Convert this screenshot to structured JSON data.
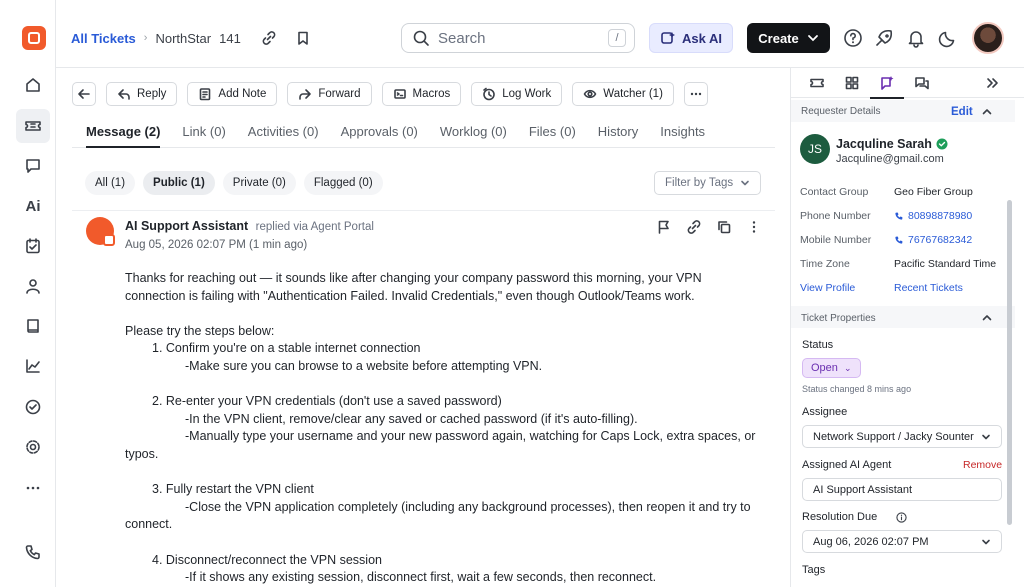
{
  "breadcrumb": {
    "root": "All Tickets",
    "project": "NorthStar",
    "ticket_id": "141"
  },
  "search": {
    "placeholder": "Search",
    "shortcut": "/"
  },
  "header": {
    "ask_ai_label": "Ask AI",
    "create_label": "Create"
  },
  "icons": {
    "rail": [
      "home-icon",
      "ticket-icon",
      "chat-icon",
      "ai-icon",
      "task-icon",
      "contacts-icon",
      "knowledge-icon",
      "reports-icon",
      "check-icon",
      "settings-icon",
      "more-icon",
      "phone-icon"
    ],
    "rail_ai_text": "Ai"
  },
  "actions": {
    "reply": "Reply",
    "add_note": "Add Note",
    "forward": "Forward",
    "macros": "Macros",
    "log_work": "Log Work",
    "watcher": "Watcher (1)"
  },
  "tabs": [
    "Message (2)",
    "Link (0)",
    "Activities (0)",
    "Approvals (0)",
    "Worklog (0)",
    "Files (0)",
    "History",
    "Insights"
  ],
  "filters": {
    "all": "All (1)",
    "public": "Public (1)",
    "private": "Private (0)",
    "flagged": "Flagged (0)",
    "tag_placeholder": "Filter by Tags"
  },
  "message": {
    "author": "AI Support Assistant",
    "via": "replied via Agent Portal",
    "date": "Aug 05, 2026 02:07 PM (1 min ago)",
    "lines": {
      "l1": "Thanks for reaching out — it sounds like after changing your company password this morning, your VPN connection is failing with \"Authentication Failed. Invalid Credentials,\" even though Outlook/Teams work.",
      "l2": "Please try the steps below:",
      "l3": "1. Confirm you're on a stable internet connection",
      "l4": "-Make sure you can browse to a website before attempting VPN.",
      "l5": "2. Re-enter your VPN credentials (don't use a saved password)",
      "l6": "-In the VPN client, remove/clear any saved or cached password (if it's auto-filling).",
      "l7": "-Manually type your username and your new password again, watching for Caps Lock, extra spaces, or typos.",
      "l8": "3. Fully restart the VPN client",
      "l9": "-Close the VPN application completely (including any background processes), then reopen it and try to connect.",
      "l10": "4. Disconnect/reconnect the VPN session",
      "l11": "-If it shows any existing session, disconnect first, wait a few seconds, then reconnect."
    }
  },
  "requester": {
    "section_title": "Requester Details",
    "edit_label": "Edit",
    "initials": "JS",
    "name": "Jacquline Sarah",
    "email": "Jacquline@gmail.com",
    "contact_group_label": "Contact Group",
    "contact_group": "Geo Fiber Group",
    "phone_label": "Phone Number",
    "phone": "80898878980",
    "mobile_label": "Mobile Number",
    "mobile": "76767682342",
    "timezone_label": "Time Zone",
    "timezone": "Pacific Standard Time",
    "view_profile": "View Profile",
    "recent_tickets": "Recent Tickets"
  },
  "ticket_properties": {
    "section_title": "Ticket Properties",
    "status_label": "Status",
    "status_value": "Open",
    "status_note": "Status changed 8 mins ago",
    "assignee_label": "Assignee",
    "assignee_value": "Network Support / Jacky Sounter",
    "ai_agent_label": "Assigned AI Agent",
    "remove_label": "Remove",
    "ai_agent_value": "AI Support Assistant",
    "resolution_label": "Resolution Due",
    "resolution_value": "Aug 06, 2026 02:07 PM",
    "tags_label": "Tags"
  },
  "colors": {
    "brand": "#f15a2b",
    "link": "#2a5bd7",
    "status_open": "#6a2fb0",
    "danger": "#c62828"
  }
}
